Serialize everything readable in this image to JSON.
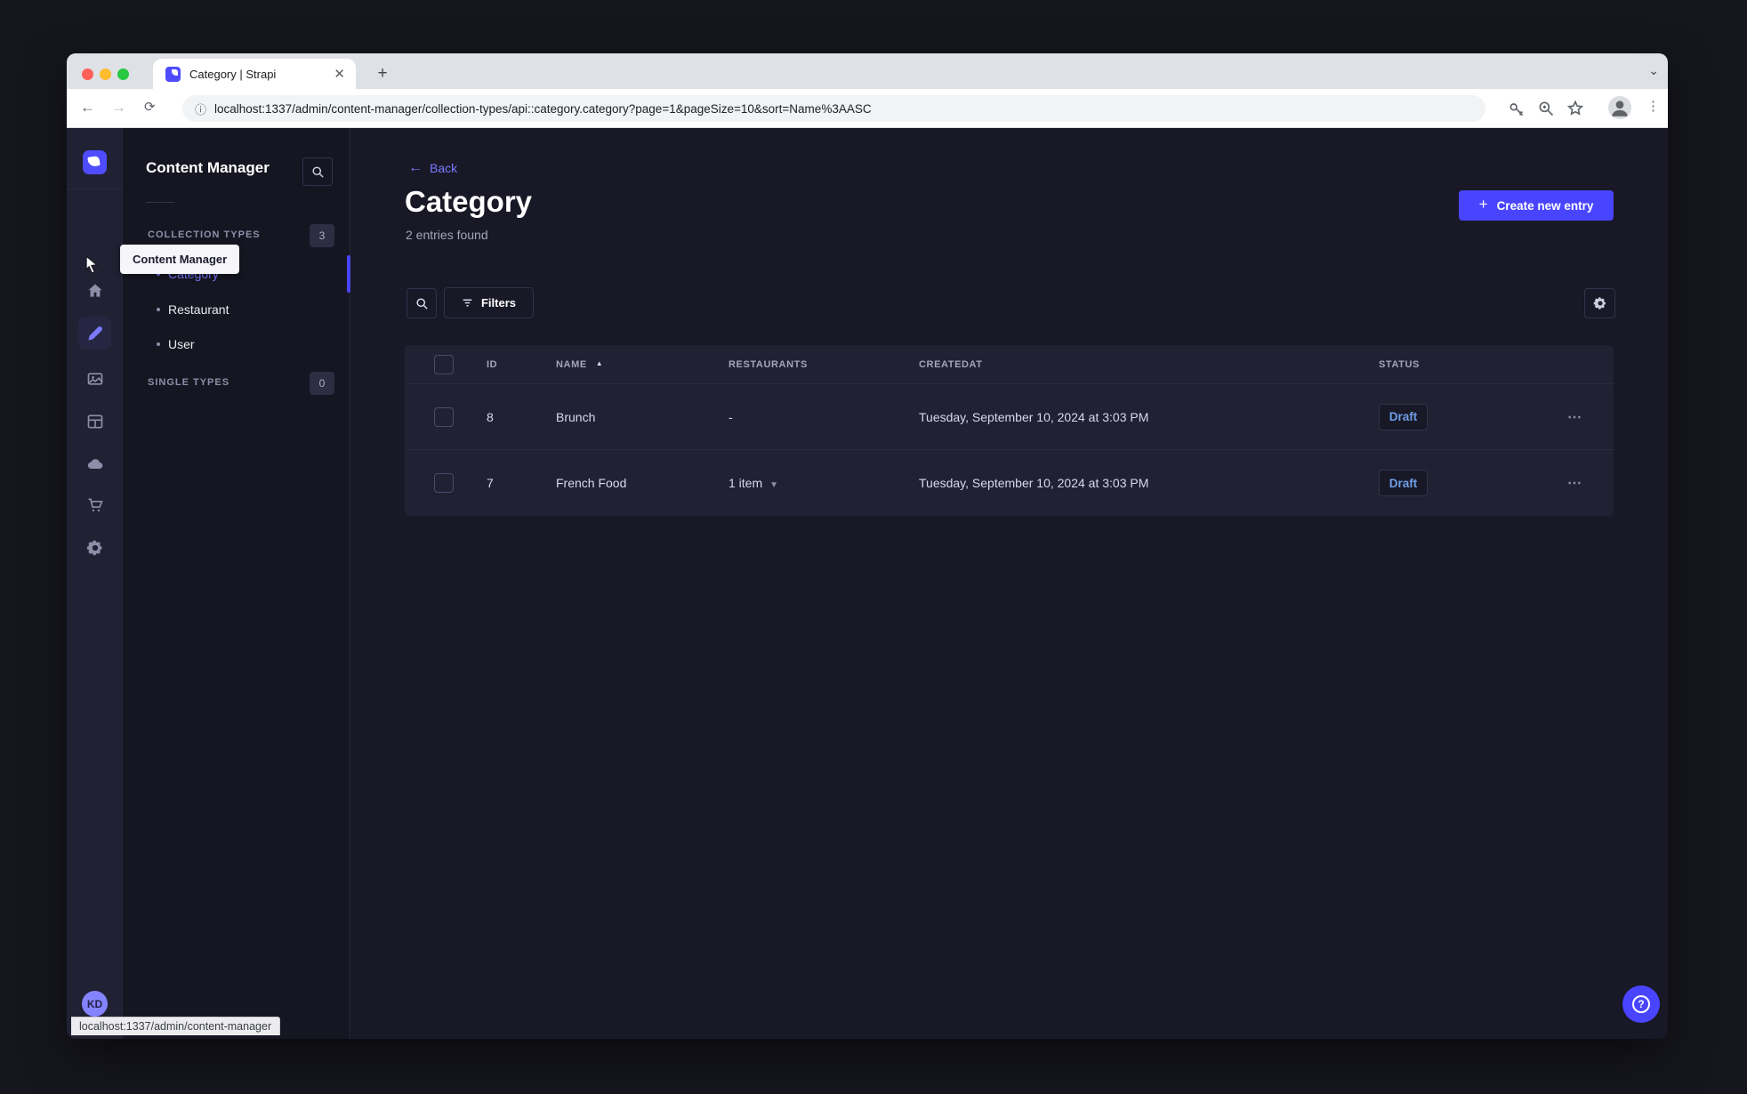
{
  "browser": {
    "tab_title": "Category | Strapi",
    "new_tab_label": "+",
    "close_label": "✕",
    "url": "localhost:1337/admin/content-manager/collection-types/api::category.category?page=1&pageSize=10&sort=Name%3AASC",
    "status_bar_text": "localhost:1337/admin/content-manager",
    "icons": [
      "back-arrow",
      "forward-arrow",
      "reload",
      "info",
      "key",
      "zoom-magnifier",
      "star",
      "profile",
      "kebab-menu",
      "tabstrip-chevron"
    ]
  },
  "rail": {
    "items": [
      {
        "name": "home",
        "icon": "home-icon"
      },
      {
        "name": "content-manager",
        "icon": "pen-icon",
        "active": true
      },
      {
        "name": "media-library",
        "icon": "pictures-icon"
      },
      {
        "name": "content-type-builder",
        "icon": "layout-icon"
      },
      {
        "name": "deploy",
        "icon": "cloud-icon"
      },
      {
        "name": "marketplace",
        "icon": "cart-icon"
      },
      {
        "name": "settings",
        "icon": "gear-icon"
      }
    ],
    "avatar_initials": "KD"
  },
  "subnav": {
    "title": "Content Manager",
    "tooltip": "Content Manager",
    "sections": [
      {
        "label": "COLLECTION TYPES",
        "badge": "3",
        "items": [
          {
            "label": "Category",
            "active": true
          },
          {
            "label": "Restaurant",
            "active": false
          },
          {
            "label": "User",
            "active": false
          }
        ]
      },
      {
        "label": "SINGLE TYPES",
        "badge": "0",
        "items": []
      }
    ]
  },
  "main": {
    "back_label": "Back",
    "title": "Category",
    "subtitle": "2 entries found",
    "create_button_label": "Create new entry",
    "filters_button_label": "Filters",
    "table": {
      "columns": {
        "id": "ID",
        "name": "NAME",
        "restaurants": "RESTAURANTS",
        "createdat": "CREATEDAT",
        "status": "STATUS"
      },
      "sort": {
        "column": "NAME",
        "direction": "ASC"
      },
      "rows": [
        {
          "id": "8",
          "name": "Brunch",
          "restaurants": "-",
          "restaurants_expandable": false,
          "createdat": "Tuesday, September 10, 2024 at 3:03 PM",
          "status": "Draft"
        },
        {
          "id": "7",
          "name": "French Food",
          "restaurants": "1 item",
          "restaurants_expandable": true,
          "createdat": "Tuesday, September 10, 2024 at 3:03 PM",
          "status": "Draft"
        }
      ],
      "row_actions_label": "⋯"
    }
  },
  "colors": {
    "accent": "#4945ff",
    "link": "#7b79ff",
    "page_bg": "#181826",
    "surface_bg": "#212134",
    "draft_text": "#6f9fe8"
  }
}
